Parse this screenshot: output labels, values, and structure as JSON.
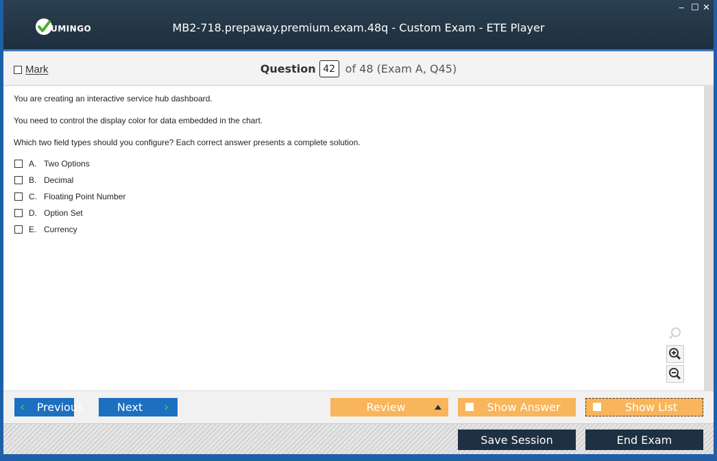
{
  "window": {
    "title": "MB2-718.prepaway.premium.exam.48q - Custom Exam - ETE Player",
    "logo_text": "UMINGO",
    "controls": {
      "minimize": "‒",
      "maximize": "☐",
      "close": "✕"
    }
  },
  "header": {
    "mark_label": "Mark",
    "question_label": "Question",
    "question_number": "42",
    "question_suffix": "of 48 (Exam A, Q45)"
  },
  "question": {
    "lines": [
      "You are creating an interactive service hub dashboard.",
      "You need to control the display color for data embedded in the chart.",
      "Which two field types should you configure? Each correct answer presents a complete solution."
    ],
    "options": [
      {
        "letter": "A.",
        "text": "Two Options"
      },
      {
        "letter": "B.",
        "text": "Decimal"
      },
      {
        "letter": "C.",
        "text": "Floating Point Number"
      },
      {
        "letter": "D.",
        "text": "Option Set"
      },
      {
        "letter": "E.",
        "text": "Currency"
      }
    ]
  },
  "navigation": {
    "previous": "Previous",
    "next": "Next",
    "review": "Review",
    "show_answer": "Show Answer",
    "show_list": "Show List"
  },
  "footer": {
    "save_session": "Save Session",
    "end_exam": "End Exam"
  },
  "colors": {
    "accent_blue": "#1d6fc0",
    "accent_orange": "#f9b55b",
    "navy": "#1d3142",
    "logo_green": "#4caf2e"
  }
}
